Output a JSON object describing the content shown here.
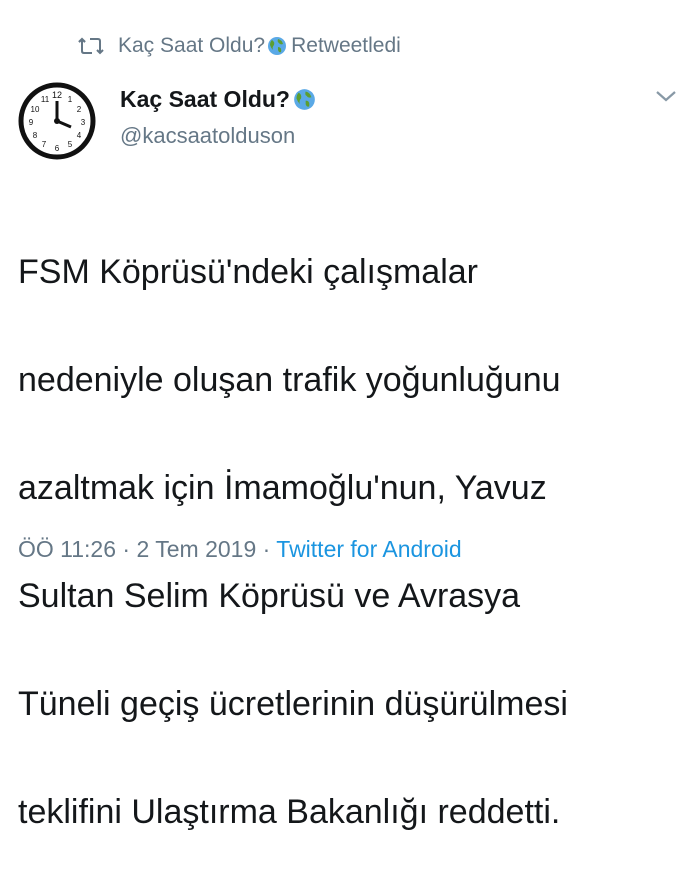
{
  "retweet": {
    "account": "Kaç Saat Oldu?",
    "label": "Retweetledi",
    "icon": "retweet-icon"
  },
  "author": {
    "name": "Kaç Saat Oldu?",
    "handle": "@kacsaatolduson",
    "avatar_icon": "clock-avatar",
    "emoji_icon": "globe-icon"
  },
  "tweet": {
    "text_lines": [
      "FSM Köprüsü'ndeki çalışmalar",
      "nedeniyle oluşan trafik yoğunluğunu",
      "azaltmak için İmamoğlu'nun, Yavuz",
      "Sultan Selim Köprüsü ve Avrasya",
      "Tüneli geçiş ücretlerinin düşürülmesi",
      "teklifini Ulaştırma Bakanlığı reddetti."
    ]
  },
  "meta": {
    "time": "ÖÖ 11:26",
    "sep1": " · ",
    "date": "2 Tem 2019",
    "sep2": " · ",
    "source": "Twitter for Android"
  },
  "colors": {
    "text": "#14171a",
    "secondary": "#657786",
    "link": "#1b95e0"
  }
}
